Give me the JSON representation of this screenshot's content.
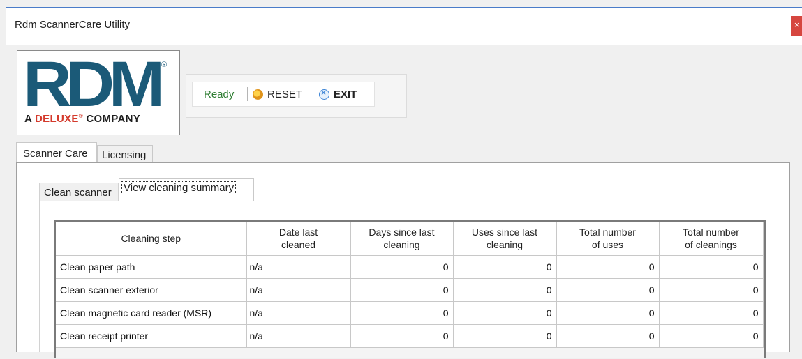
{
  "window": {
    "title": "Rdm ScannerCare Utility",
    "close_glyph": "×"
  },
  "logo": {
    "brand": "RDM",
    "registered": "®",
    "tagline_prefix": "A ",
    "tagline_brand": "DELUXE",
    "tagline_mark": "®",
    "tagline_suffix": " COMPANY",
    "colors": {
      "brand": "#1b5a78",
      "deluxe": "#d43a2c"
    }
  },
  "toolbar": {
    "status": "Ready",
    "reset_label": "RESET",
    "exit_label": "EXIT",
    "reset_icon": "reset-icon",
    "exit_icon": "exit-icon",
    "status_color": "#2e7d32"
  },
  "main_tabs": [
    {
      "label": "Scanner Care",
      "active": true
    },
    {
      "label": "Licensing",
      "active": false
    }
  ],
  "sub_tabs": [
    {
      "label": "Clean scanner",
      "active": false
    },
    {
      "label": "View cleaning summary",
      "active": true
    }
  ],
  "summary_table": {
    "headers": [
      "Cleaning step",
      "Date last\ncleaned",
      "Days since last\ncleaning",
      "Uses since last\ncleaning",
      "Total number\nof uses",
      "Total number\nof cleanings"
    ],
    "rows": [
      [
        "Clean paper path",
        "n/a",
        "0",
        "0",
        "0",
        "0"
      ],
      [
        "Clean scanner exterior",
        "n/a",
        "0",
        "0",
        "0",
        "0"
      ],
      [
        "Clean magnetic card reader (MSR)",
        "n/a",
        "0",
        "0",
        "0",
        "0"
      ],
      [
        "Clean receipt printer",
        "n/a",
        "0",
        "0",
        "0",
        "0"
      ]
    ]
  }
}
